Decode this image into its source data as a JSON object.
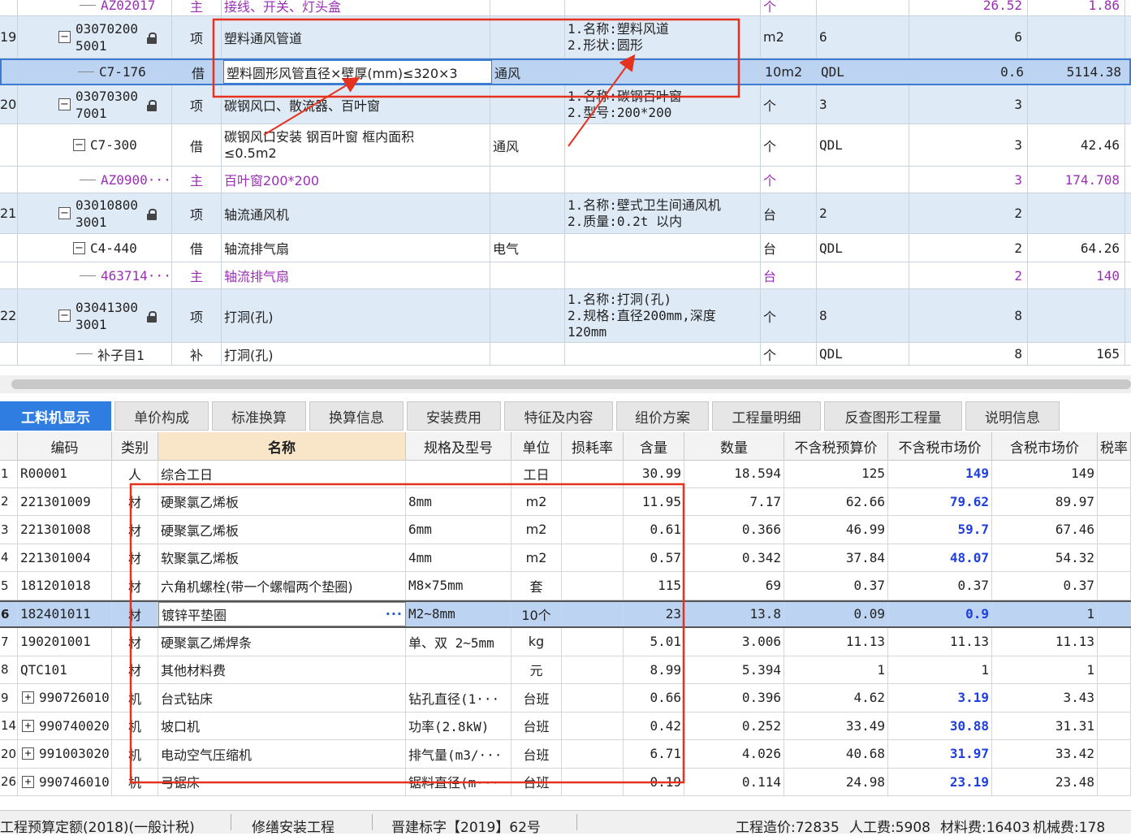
{
  "top_rows": [
    {
      "kind": "sub",
      "num": "",
      "code": "AZ02017",
      "type": "主",
      "name": "接线、开关、灯头盒",
      "spec": "",
      "feature": "",
      "unit": "个",
      "qty": "",
      "qty2": "",
      "price": "26.52",
      "price2": "1.86",
      "purple": true
    },
    {
      "kind": "item",
      "num": "19",
      "code": "030702005001",
      "type": "项",
      "name": "塑料通风管道",
      "spec": "",
      "feature": "1.名称:塑料风道\n2.形状:圆形",
      "unit": "m2",
      "qty": "6",
      "qty2": "",
      "price": "6",
      "price2": ""
    },
    {
      "kind": "sel",
      "num": "",
      "code": "C7-176",
      "type": "借",
      "name": "塑料圆形风管直径×壁厚(mm)≤320×3",
      "spec": "通风",
      "feature": "",
      "unit": "10m2",
      "qty": "QDL",
      "qty2": "",
      "price": "0.6",
      "price2": "5114.38"
    },
    {
      "kind": "item",
      "num": "20",
      "code": "030703007001",
      "type": "项",
      "name": "碳钢风口、散流器、百叶窗",
      "spec": "",
      "feature": "1.名称:碳钢百叶窗\n2.型号:200*200",
      "unit": "个",
      "qty": "3",
      "qty2": "",
      "price": "3",
      "price2": ""
    },
    {
      "kind": "child",
      "num": "",
      "code": "C7-300",
      "type": "借",
      "name": "碳钢风口安装 钢百叶窗 框内面积\n≤0.5m2",
      "spec": "通风",
      "feature": "",
      "unit": "个",
      "qty": "QDL",
      "qty2": "",
      "price": "3",
      "price2": "42.46"
    },
    {
      "kind": "sub",
      "num": "",
      "code": "AZ0900···",
      "type": "主",
      "name": "百叶窗200*200",
      "spec": "",
      "feature": "",
      "unit": "个",
      "qty": "",
      "qty2": "",
      "price": "3",
      "price2": "174.708",
      "purple": true
    },
    {
      "kind": "item",
      "num": "21",
      "code": "030108003001",
      "type": "项",
      "name": "轴流通风机",
      "spec": "",
      "feature": "1.名称:壁式卫生间通风机\n2.质量:0.2t 以内",
      "unit": "台",
      "qty": "2",
      "qty2": "",
      "price": "2",
      "price2": ""
    },
    {
      "kind": "child",
      "num": "",
      "code": "C4-440",
      "type": "借",
      "name": "轴流排气扇",
      "spec": "电气",
      "feature": "",
      "unit": "台",
      "qty": "QDL",
      "qty2": "",
      "price": "2",
      "price2": "64.26"
    },
    {
      "kind": "sub",
      "num": "",
      "code": "463714···",
      "type": "主",
      "name": "轴流排气扇",
      "spec": "",
      "feature": "",
      "unit": "台",
      "qty": "",
      "qty2": "",
      "price": "2",
      "price2": "140",
      "purple": true
    },
    {
      "kind": "item",
      "num": "22",
      "code": "030413003001",
      "type": "项",
      "name": "打洞(孔)",
      "spec": "",
      "feature": "1.名称:打洞(孔)\n2.规格:直径200mm,深度\n120mm",
      "unit": "个",
      "qty": "8",
      "qty2": "",
      "price": "8",
      "price2": ""
    },
    {
      "kind": "leaf",
      "num": "",
      "code": "补子目1",
      "type": "补",
      "name": "打洞(孔)",
      "spec": "",
      "feature": "",
      "unit": "个",
      "qty": "QDL",
      "qty2": "",
      "price": "8",
      "price2": "165"
    }
  ],
  "tabs": [
    "工料机显示",
    "单价构成",
    "标准换算",
    "换算信息",
    "安装费用",
    "特征及内容",
    "组价方案",
    "工程量明细",
    "反查图形工程量",
    "说明信息"
  ],
  "columns": [
    "编码",
    "类别",
    "名称",
    "规格及型号",
    "单位",
    "损耗率",
    "含量",
    "数量",
    "不含税预算价",
    "不含税市场价",
    "含税市场价",
    "税率"
  ],
  "rows": [
    {
      "idx": "1",
      "code": "R00001",
      "cat": "人",
      "name": "综合工日",
      "spec": "",
      "unit": "工日",
      "loss": "",
      "content": "30.99",
      "qty": "18.594",
      "budget": "125",
      "market": "149",
      "taxed": "149",
      "exp": false
    },
    {
      "idx": "2",
      "code": "221301009",
      "cat": "材",
      "name": "硬聚氯乙烯板",
      "spec": "8mm",
      "unit": "m2",
      "loss": "",
      "content": "11.95",
      "qty": "7.17",
      "budget": "62.66",
      "market": "79.62",
      "taxed": "89.97",
      "exp": false
    },
    {
      "idx": "3",
      "code": "221301008",
      "cat": "材",
      "name": "硬聚氯乙烯板",
      "spec": "6mm",
      "unit": "m2",
      "loss": "",
      "content": "0.61",
      "qty": "0.366",
      "budget": "46.99",
      "market": "59.7",
      "taxed": "67.46",
      "exp": false
    },
    {
      "idx": "4",
      "code": "221301004",
      "cat": "材",
      "name": "软聚氯乙烯板",
      "spec": "4mm",
      "unit": "m2",
      "loss": "",
      "content": "0.57",
      "qty": "0.342",
      "budget": "37.84",
      "market": "48.07",
      "taxed": "54.32",
      "exp": false
    },
    {
      "idx": "5",
      "code": "181201018",
      "cat": "材",
      "name": "六角机螺栓(带一个螺帽两个垫圈)",
      "spec": "M8×75mm",
      "unit": "套",
      "loss": "",
      "content": "115",
      "qty": "69",
      "budget": "0.37",
      "market": "0.37",
      "taxed": "0.37",
      "exp": false
    },
    {
      "idx": "6",
      "code": "182401011",
      "cat": "材",
      "name": "镀锌平垫圈",
      "spec": "M2~8mm",
      "unit": "10个",
      "loss": "",
      "content": "23",
      "qty": "13.8",
      "budget": "0.09",
      "market": "0.9",
      "taxed": "1",
      "exp": false,
      "sel": true
    },
    {
      "idx": "7",
      "code": "190201001",
      "cat": "材",
      "name": "硬聚氯乙烯焊条",
      "spec": "单、双 2~5mm",
      "unit": "kg",
      "loss": "",
      "content": "5.01",
      "qty": "3.006",
      "budget": "11.13",
      "market": "11.13",
      "taxed": "11.13",
      "exp": false
    },
    {
      "idx": "8",
      "code": "QTC101",
      "cat": "材",
      "name": "其他材料费",
      "spec": "",
      "unit": "元",
      "loss": "",
      "content": "8.99",
      "qty": "5.394",
      "budget": "1",
      "market": "1",
      "taxed": "1",
      "exp": false
    },
    {
      "idx": "9",
      "code": "990726010",
      "cat": "机",
      "name": "台式钻床",
      "spec": "钻孔直径(1···",
      "unit": "台班",
      "loss": "",
      "content": "0.66",
      "qty": "0.396",
      "budget": "4.62",
      "market": "3.19",
      "taxed": "3.43",
      "exp": true
    },
    {
      "idx": "14",
      "code": "990740020",
      "cat": "机",
      "name": "坡口机",
      "spec": "功率(2.8kW)",
      "unit": "台班",
      "loss": "",
      "content": "0.42",
      "qty": "0.252",
      "budget": "33.49",
      "market": "30.88",
      "taxed": "31.31",
      "exp": true
    },
    {
      "idx": "20",
      "code": "991003020",
      "cat": "机",
      "name": "电动空气压缩机",
      "spec": "排气量(m3/···",
      "unit": "台班",
      "loss": "",
      "content": "6.71",
      "qty": "4.026",
      "budget": "40.68",
      "market": "31.97",
      "taxed": "33.42",
      "exp": true
    },
    {
      "idx": "26",
      "code": "990746010",
      "cat": "机",
      "name": "弓锯床",
      "spec": "锯料直径(m···",
      "unit": "台班",
      "loss": "",
      "content": "0.19",
      "qty": "0.114",
      "budget": "24.98",
      "market": "23.19",
      "taxed": "23.48",
      "exp": true
    }
  ],
  "status": {
    "quota": "工程预算定额(2018)(一般计税)",
    "project_type": "修缮安装工程",
    "doc": "晋建标字【2019】62号",
    "total": "工程造价:72835",
    "labor": "人工费:5908",
    "material": "材料费:16403",
    "machine": "机械费:178"
  },
  "colors": {
    "accent": "#2f7de1",
    "highlight": "#e5321f",
    "purple": "#9a2fb4",
    "blue_price": "#1f3fe0"
  }
}
